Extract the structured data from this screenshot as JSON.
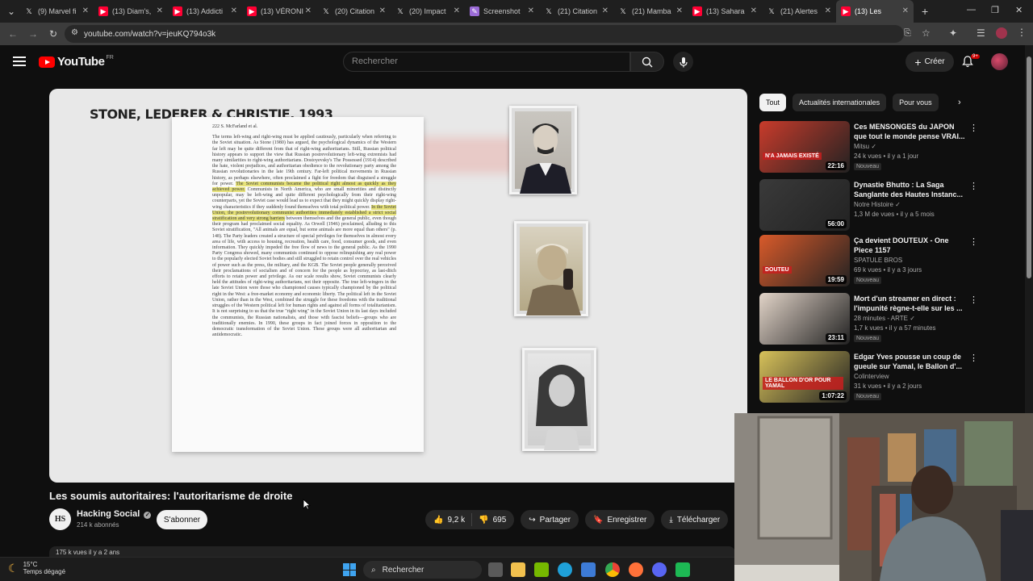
{
  "browser": {
    "tabs": [
      {
        "label": "(9) Marvel fi",
        "icon": "x-logo-icon",
        "color": "#e8e8e8"
      },
      {
        "label": "(13) Diam's,",
        "icon": "youtube-icon",
        "color": "#ff0033"
      },
      {
        "label": "(13) Addicti",
        "icon": "youtube-icon",
        "color": "#ff0033"
      },
      {
        "label": "(13) VÉRONI",
        "icon": "youtube-icon",
        "color": "#ff0033"
      },
      {
        "label": "(20) Citation",
        "icon": "x-logo-icon",
        "color": "#e8e8e8"
      },
      {
        "label": "(20) Impact",
        "icon": "x-logo-icon",
        "color": "#e8e8e8"
      },
      {
        "label": "Screenshot",
        "icon": "screenshot-icon",
        "color": "#9b6bd6"
      },
      {
        "label": "(21) Citation",
        "icon": "x-logo-icon",
        "color": "#e8e8e8"
      },
      {
        "label": "(21) Mamba",
        "icon": "x-logo-icon",
        "color": "#e8e8e8"
      },
      {
        "label": "(13) Sahara",
        "icon": "youtube-icon",
        "color": "#ff0033"
      },
      {
        "label": "(21) Alertes",
        "icon": "x-logo-icon",
        "color": "#e8e8e8"
      },
      {
        "label": "(13) Les",
        "icon": "youtube-icon",
        "color": "#ff0033",
        "active": true
      }
    ],
    "url": "youtube.com/watch?v=jeuKQ794o3k"
  },
  "header": {
    "logo_text": "YouTube",
    "country": "FR",
    "search_placeholder": "Rechercher",
    "create_label": "Créer",
    "notif_badge": "9+"
  },
  "video": {
    "slide_title": "STONE, LEDERER & CHRISTIE, 1993",
    "paper_header": "222     S. McFarland et al.",
    "title": "Les soumis autoritaires: l'autoritarisme de droite",
    "channel_initials": "HS",
    "channel_name": "Hacking Social",
    "subscribers": "214 k abonnés",
    "subscribe_label": "S'abonner",
    "likes": "9,2 k",
    "dislikes": "695",
    "share_label": "Partager",
    "save_label": "Enregistrer",
    "download_label": "Télécharger",
    "description_preview": "175 k vues  il y a 2 ans"
  },
  "chips": [
    {
      "label": "Tout",
      "active": true
    },
    {
      "label": "Actualités internationales",
      "active": false
    },
    {
      "label": "Pour vous",
      "active": false
    }
  ],
  "recommendations": [
    {
      "title": "Ces MENSONGES du JAPON que tout le monde pense VRAI...",
      "channel": "Mitsu",
      "verified": true,
      "meta": "24 k vues • il y a 1 jour",
      "badge": "Nouveau",
      "duration": "22:16",
      "thumb_text": "N'A JAMAIS EXISTÉ",
      "thumb_color": "#c93b2b"
    },
    {
      "title": "Dynastie Bhutto : La Saga Sanglante des Hautes Instanc...",
      "channel": "Notre Histoire",
      "verified": true,
      "meta": "1,3 M de vues • il y a 5 mois",
      "badge": "",
      "duration": "56:00",
      "thumb_text": "",
      "thumb_color": "#3a3a3a"
    },
    {
      "title": "Ça devient DOUTEUX - One Piece 1157",
      "channel": "SPATULE BROS",
      "verified": false,
      "meta": "69 k vues • il y a 3 jours",
      "badge": "Nouveau",
      "duration": "19:59",
      "thumb_text": "DOUTEU",
      "thumb_color": "#d95a2a"
    },
    {
      "title": "Mort d'un streamer en direct : l'impunité règne-t-elle sur les ...",
      "channel": "28 minutes - ARTE",
      "verified": true,
      "meta": "1,7 k vues • il y a 57 minutes",
      "badge": "Nouveau",
      "duration": "23:11",
      "thumb_text": "",
      "thumb_color": "#e2d4c8"
    },
    {
      "title": "Edgar Yves pousse un coup de gueule sur Yamal, le Ballon d'...",
      "channel": "Colinterview",
      "verified": false,
      "meta": "31 k vues • il y a 2 jours",
      "badge": "Nouveau",
      "duration": "1:07:22",
      "thumb_text": "LE BALLON D'OR POUR YAMAL",
      "thumb_color": "#d8c25a"
    }
  ],
  "taskbar": {
    "temperature": "15°C",
    "weather": "Temps dégagé",
    "search_label": "Rechercher"
  }
}
